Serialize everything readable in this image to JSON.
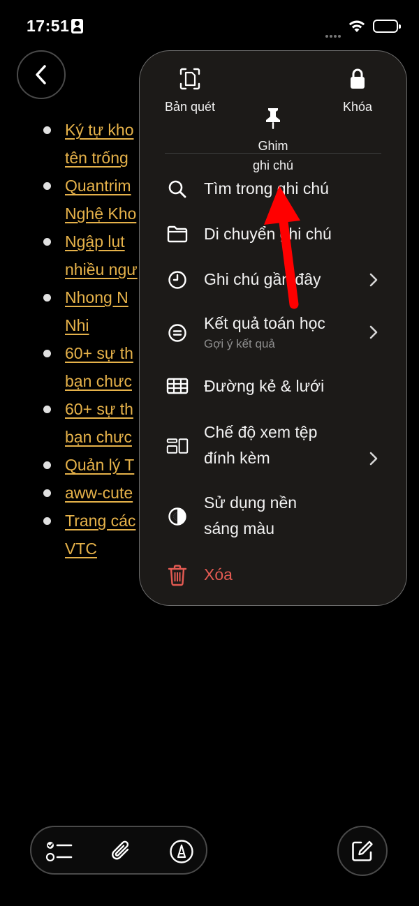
{
  "status_bar": {
    "time": "17:51"
  },
  "notes": {
    "items": [
      {
        "lines": [
          "Ký tự kho",
          "tên trống"
        ]
      },
      {
        "lines": [
          "Quantrim",
          "Nghệ Kho"
        ]
      },
      {
        "lines": [
          "Ngập lụt",
          "nhiều ngư"
        ]
      },
      {
        "lines": [
          "Nhong N",
          "Nhi"
        ]
      },
      {
        "lines": [
          "60+ sự th",
          "bạn chưc"
        ]
      },
      {
        "lines": [
          "60+ sự th",
          "bạn chưc"
        ]
      },
      {
        "lines": [
          "Quản lý T"
        ]
      },
      {
        "lines": [
          "aww-cute"
        ]
      },
      {
        "lines": [
          "Trang các",
          "VTC"
        ]
      }
    ]
  },
  "menu": {
    "top_actions": [
      {
        "label": "Bản quét",
        "icon": "scan-document-icon"
      },
      {
        "label": "Ghim\nghi chú",
        "icon": "pin-icon"
      },
      {
        "label": "Khóa",
        "icon": "lock-icon"
      }
    ],
    "items": [
      {
        "label": "Tìm trong ghi chú",
        "icon": "search-icon"
      },
      {
        "label": "Di chuyển ghi chú",
        "icon": "folder-icon"
      },
      {
        "label": "Ghi chú gần đây",
        "icon": "clock-icon"
      },
      {
        "label": "Kết quả toán học",
        "sublabel": "Gợi ý kết quả",
        "icon": "math-equals-icon"
      },
      {
        "label": "Đường kẻ & lưới",
        "icon": "grid-icon"
      },
      {
        "label": "Chế độ xem tệp\nđính kèm",
        "icon": "attachment-view-icon"
      },
      {
        "label": "Sử dụng nền\nsáng màu",
        "icon": "contrast-icon"
      },
      {
        "label": "Xóa",
        "icon": "trash-icon",
        "destructive_color": "#e35a52"
      }
    ]
  },
  "colors": {
    "link": "#e6b24a",
    "annotation_arrow": "#ff0000",
    "destructive": "#e35a52"
  },
  "toolbar": {
    "icons": [
      "checklist-icon",
      "paperclip-icon",
      "markup-pen-icon",
      "compose-icon"
    ]
  }
}
